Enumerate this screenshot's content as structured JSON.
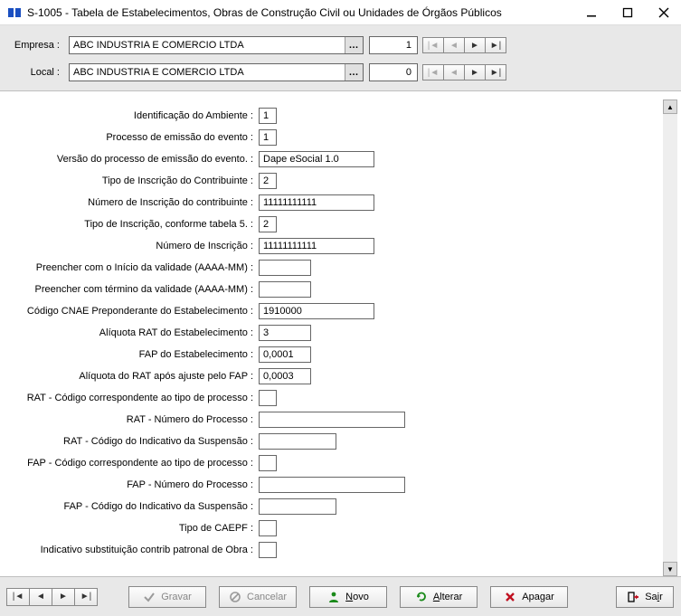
{
  "window": {
    "title": "S-1005 - Tabela de Estabelecimentos, Obras de Construção Civil ou Unidades de Órgãos Públicos"
  },
  "header": {
    "empresa_label": "Empresa :",
    "empresa_value": "ABC INDUSTRIA E COMERCIO LTDA",
    "empresa_num": "1",
    "local_label": "Local :",
    "local_value": "ABC INDUSTRIA E COMERCIO LTDA",
    "local_num": "0"
  },
  "fields": [
    {
      "label": "Identificação do Ambiente :",
      "value": "1",
      "w": "w-tiny"
    },
    {
      "label": "Processo de emissão do evento :",
      "value": "1",
      "w": "w-tiny"
    },
    {
      "label": "Versão do processo de emissão do evento. :",
      "value": "Dape eSocial 1.0",
      "w": "w-md"
    },
    {
      "label": "Tipo de Inscrição do Contribuinte :",
      "value": "2",
      "w": "w-tiny"
    },
    {
      "label": "Número de Inscrição do contribuinte :",
      "value": "11111111111",
      "w": "w-md"
    },
    {
      "label": "Tipo de Inscrição, conforme tabela 5. :",
      "value": "2",
      "w": "w-tiny"
    },
    {
      "label": "Número de Inscrição :",
      "value": "11111111111",
      "w": "w-md"
    },
    {
      "label": "Preencher com o Início da validade (AAAA-MM) :",
      "value": "",
      "w": "w-sm"
    },
    {
      "label": "Preencher com término da validade (AAAA-MM) :",
      "value": "",
      "w": "w-sm"
    },
    {
      "label": "Código CNAE Preponderante do Estabelecimento :",
      "value": "1910000",
      "w": "w-md"
    },
    {
      "label": "Alíquota RAT do Estabelecimento :",
      "value": "3",
      "w": "w-sm"
    },
    {
      "label": "FAP do Estabelecimento :",
      "value": "0,0001",
      "w": "w-sm"
    },
    {
      "label": "Alíquota do RAT após ajuste pelo FAP :",
      "value": "0,0003",
      "w": "w-sm"
    },
    {
      "label": "RAT - Código correspondente ao tipo de processo :",
      "value": "",
      "w": "w-tiny"
    },
    {
      "label": "RAT - Número do Processo :",
      "value": "",
      "w": "w-lg"
    },
    {
      "label": "RAT - Código do Indicativo da Suspensão :",
      "value": "",
      "w": "w-wide"
    },
    {
      "label": "FAP - Código correspondente ao tipo de processo :",
      "value": "",
      "w": "w-tiny"
    },
    {
      "label": "FAP - Número do Processo :",
      "value": "",
      "w": "w-lg"
    },
    {
      "label": "FAP - Código do Indicativo da Suspensão :",
      "value": "",
      "w": "w-wide"
    },
    {
      "label": "Tipo de CAEPF :",
      "value": "",
      "w": "w-tiny"
    },
    {
      "label": "Indicativo substituição contrib patronal de Obra :",
      "value": "",
      "w": "w-tiny"
    }
  ],
  "footer": {
    "gravar": "Gravar",
    "cancelar": "Cancelar",
    "novo": "Novo",
    "alterar": "Alterar",
    "apagar": "Apagar",
    "sair": "Sair"
  },
  "icons": {
    "first": "|◄",
    "prev": "◄",
    "next": "►",
    "last": "►|"
  }
}
